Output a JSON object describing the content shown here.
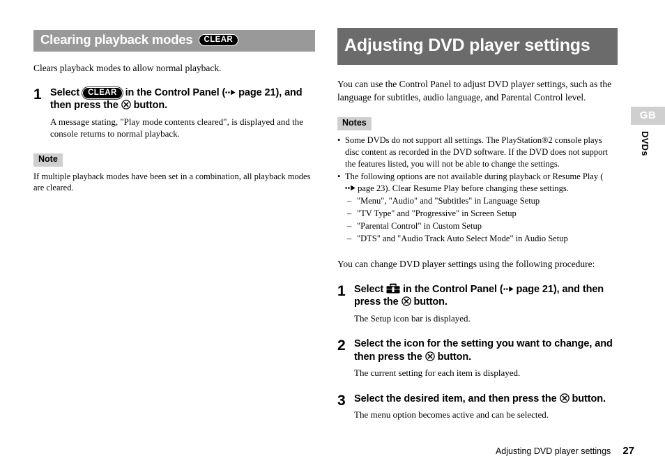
{
  "page": {
    "footer_title": "Adjusting DVD player settings",
    "footer_page_number": "27",
    "side_tab_region": "GB",
    "side_tab_section": "DVDs"
  },
  "colors": {
    "chapter_bar_bg": "#6b6b6b",
    "section_bar_bg": "#999999",
    "note_badge_bg": "#cfcfcf",
    "side_tab_bg": "#cfcfcf",
    "text": "#000000",
    "bar_text": "#ffffff"
  },
  "left_column": {
    "section_heading": "Clearing playback modes",
    "section_heading_badge": "CLEAR",
    "intro": "Clears playback modes to allow normal playback.",
    "steps": [
      {
        "number": "1",
        "title_part1": "Select",
        "title_badge": "CLEAR",
        "title_part2": "in the Control Panel (",
        "title_page_ref": "page 21",
        "title_part3": "), and then press the",
        "title_part4": "button.",
        "description": "A message stating, \"Play mode contents cleared\", is displayed and the console returns to normal playback."
      }
    ],
    "note": {
      "badge": "Note",
      "text": "If multiple playback modes have been set in a combination, all playback modes are cleared."
    }
  },
  "right_column": {
    "chapter_heading": "Adjusting DVD player settings",
    "intro": "You can use the Control Panel to adjust DVD player settings, such as the language for subtitles, audio language, and Parental Control level.",
    "notes": {
      "badge": "Notes",
      "items": [
        {
          "text": "Some DVDs do not support all settings. The PlayStation®2 console plays disc content as recorded in the DVD software. If the DVD does not support the features listed, you will not be able to change the settings.",
          "sub_items": []
        },
        {
          "text_part1": "The following options are not available during playback or Resume Play (",
          "page_ref": "page 23",
          "text_part2": "). Clear Resume Play before changing these settings.",
          "sub_items": [
            "\"Menu\", \"Audio\" and \"Subtitles\" in Language Setup",
            "\"TV Type\" and \"Progressive\" in Screen Setup",
            "\"Parental Control\" in Custom Setup",
            "\"DTS\" and \"Audio Track Auto Select Mode\" in Audio Setup"
          ]
        }
      ]
    },
    "procedure_intro": "You can change DVD player settings using the following procedure:",
    "steps": [
      {
        "number": "1",
        "title_part1": "Select",
        "title_icon": "toolbox-icon",
        "title_part2": "in the Control Panel (",
        "title_page_ref": "page 21",
        "title_part3": "), and then press the",
        "title_part4": "button.",
        "description": "The Setup icon bar is displayed."
      },
      {
        "number": "2",
        "title_part1": "Select the icon for the setting you want to change, and then press the",
        "title_part4": "button.",
        "description": "The current setting for each item is displayed."
      },
      {
        "number": "3",
        "title_part1": "Select the desired item, and then press the",
        "title_part4": "button.",
        "description": "The menu option becomes active and can be selected."
      }
    ]
  }
}
